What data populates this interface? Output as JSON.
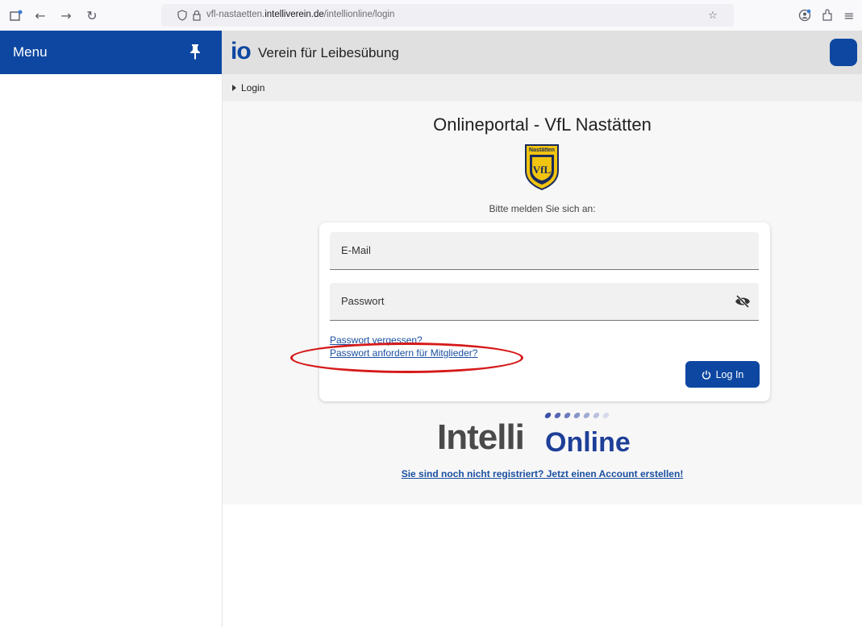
{
  "browser": {
    "url_prefix": "vfl-nastaetten.",
    "url_domain": "intelliverein.de",
    "url_path": "/intellionline/login"
  },
  "sidebar": {
    "title": "Menu"
  },
  "header": {
    "brand_mark": "io",
    "title": "Verein für Leibesübung"
  },
  "breadcrumb": {
    "current": "Login"
  },
  "login": {
    "page_title": "Onlineportal - VfL Nastätten",
    "crest_text_top": "Nastätten",
    "crest_text_main": "VfL",
    "prompt": "Bitte melden Sie sich an:",
    "email_label": "E-Mail",
    "password_label": "Passwort",
    "forgot_link": "Passwort vergessen?",
    "request_link": "Passwort anfordern für Mitglieder?",
    "login_button": "Log In"
  },
  "footer": {
    "logo_part1": "Intelli",
    "logo_part2": "Online",
    "register_link": "Sie sind noch nicht registriert? Jetzt einen Account erstellen!"
  },
  "colors": {
    "primary": "#0d47a1",
    "annotation": "#d61a1a"
  }
}
